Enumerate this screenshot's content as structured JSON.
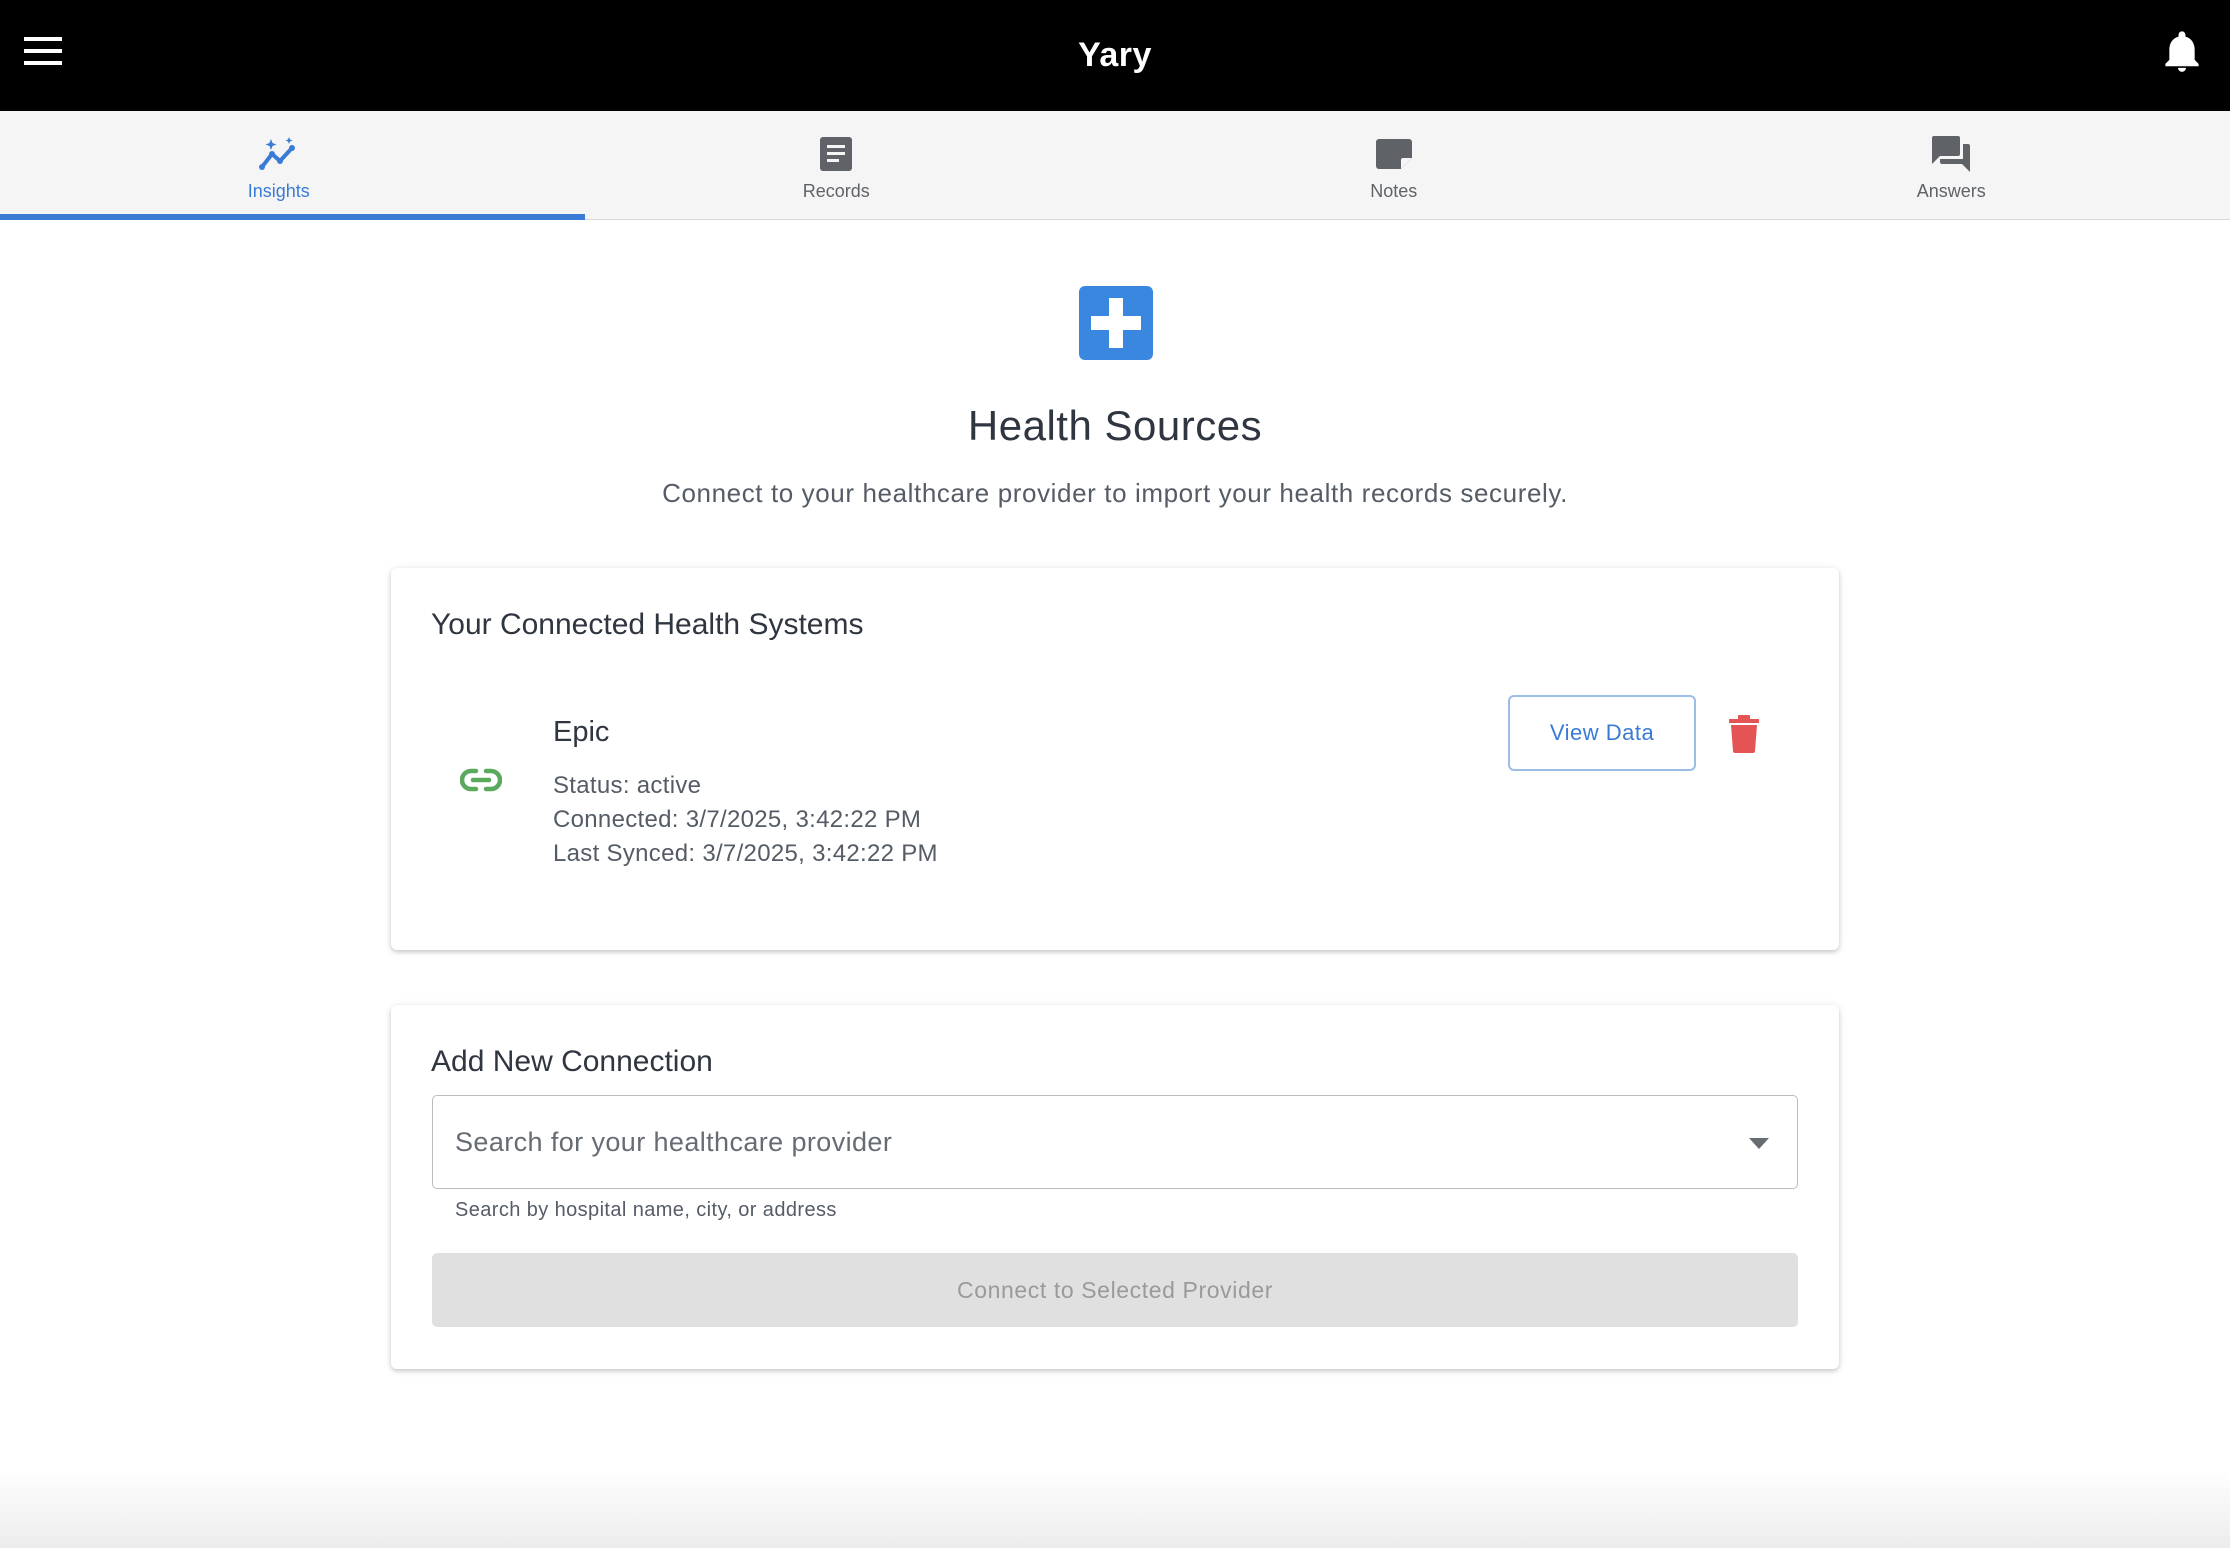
{
  "app": {
    "title": "Yary"
  },
  "tabs": [
    {
      "label": "Insights",
      "icon": "insights-icon",
      "active": true
    },
    {
      "label": "Records",
      "icon": "records-icon",
      "active": false
    },
    {
      "label": "Notes",
      "icon": "notes-icon",
      "active": false
    },
    {
      "label": "Answers",
      "icon": "answers-icon",
      "active": false
    }
  ],
  "header": {
    "title": "Health Sources",
    "subtitle": "Connect to your healthcare provider to import your health records securely."
  },
  "connected": {
    "title": "Your Connected Health Systems",
    "systems": [
      {
        "name": "Epic",
        "status": "Status: active",
        "connected": "Connected: 3/7/2025, 3:42:22 PM",
        "last_synced": "Last Synced: 3/7/2025, 3:42:22 PM",
        "view_label": "View Data"
      }
    ]
  },
  "add_connection": {
    "title": "Add New Connection",
    "search_placeholder": "Search for your healthcare provider",
    "helper": "Search by hospital name, city, or address",
    "connect_label": "Connect to Selected Provider"
  },
  "colors": {
    "accent": "#3a7bd5",
    "link_green": "#5aa95c",
    "delete_red": "#e45454",
    "appbar": "#000000"
  }
}
